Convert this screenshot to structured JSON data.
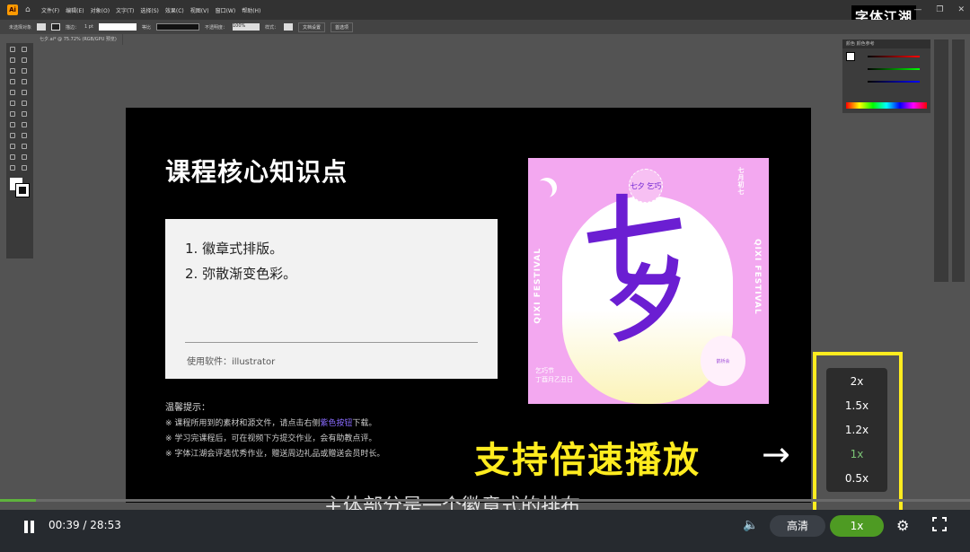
{
  "app": {
    "logo": "Ai",
    "menu": [
      "文件(F)",
      "编辑(E)",
      "对象(O)",
      "文字(T)",
      "选择(S)",
      "效果(C)",
      "视图(V)",
      "窗口(W)",
      "帮助(H)"
    ],
    "brand": "字体江湖"
  },
  "control_bar": {
    "label": "未选择对象",
    "stroke_label": "描边：",
    "stroke_value": "1 pt",
    "line_label": "等比",
    "opacity_label": "不透明度：",
    "opacity_value": "100%",
    "style_label": "样式：",
    "doc_setup": "文档设置",
    "prefs": "首选项"
  },
  "doc_tab": "七夕.ai* @ 75.72% (RGB/GPU 预览)",
  "slide": {
    "title": "课程核心知识点",
    "points": [
      "1. 徽章式排版。",
      "2. 弥散渐变色彩。"
    ],
    "software": "使用软件：illustrator",
    "tips_title": "温馨提示：",
    "tips": [
      {
        "before": "※ 课程所用到的素材和源文件，请点击右侧",
        "hl": "紫色按钮",
        "after": "下载。"
      },
      {
        "before": "※ 学习完课程后，可在视频下方提交作业，会有助教点评。",
        "hl": "",
        "after": ""
      },
      {
        "before": "※ 字体江湖会评选优秀作业，赠送周边礼品或赠送会员时长。",
        "hl": "",
        "after": ""
      }
    ]
  },
  "poster": {
    "badge": "七夕 乞巧",
    "char1": "七",
    "char2": "夕",
    "side_left": "QIXI FESTIVAL",
    "side_right": "QIXI FESTIVAL",
    "top_right": "七月初七",
    "bottom_left": "乞巧节\n丁酉月乙丑日",
    "stamp": "鹊桥会"
  },
  "overlay": {
    "caption": "支持倍速播放",
    "arrow": "→",
    "subtitle": "主体部分是一个徽章式的排布"
  },
  "panels": {
    "color_header": "颜色  颜色参考"
  },
  "speed_menu": {
    "options": [
      "2x",
      "1.5x",
      "1.2x",
      "1x",
      "0.5x"
    ],
    "active": "1x"
  },
  "player": {
    "current": "00:39",
    "total": "28:53",
    "time_text": "00:39 / 28:53",
    "progress": 0.037,
    "quality": "高清",
    "speed": "1x",
    "icons": [
      "pause-icon",
      "volume-icon",
      "gear-icon",
      "fullscreen-icon"
    ]
  },
  "colors": {
    "accent_green": "#5fb33d",
    "caption_yellow": "#ffec1f",
    "poster_pink": "#f3a8f0",
    "poster_purple": "#6b1ed2"
  }
}
